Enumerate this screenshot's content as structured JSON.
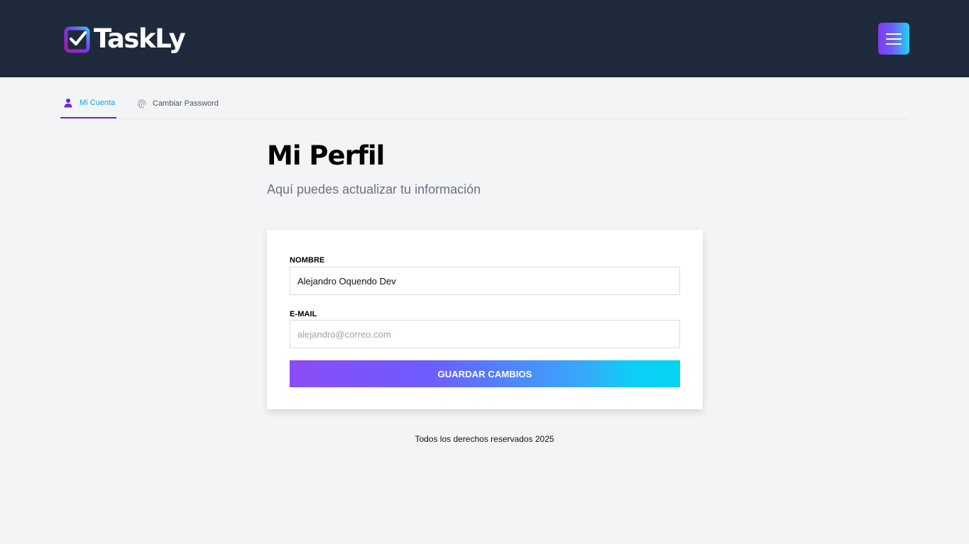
{
  "header": {
    "logo_text": "TaskLy",
    "menu_icon": "hamburger-icon",
    "colors": {
      "background": "#1e293b",
      "accent_start": "#7c3aed",
      "accent_end": "#22d3ee"
    }
  },
  "tabs": [
    {
      "label": "Mi Cuenta",
      "icon": "user-icon",
      "active": true
    },
    {
      "label": "Cambiar Password",
      "icon": "fingerprint-icon",
      "active": false
    }
  ],
  "page": {
    "title": "Mi Perfil",
    "subtitle": "Aquí puedes actualizar tu información"
  },
  "form": {
    "name_label": "Nombre",
    "name_value": "Alejandro Oquendo Dev",
    "email_label": "E-mail",
    "email_value": "",
    "email_placeholder": "alejandro@correo.com",
    "submit_label": "Guardar Cambios"
  },
  "footer": {
    "text": "Todos los derechos reservados 2025"
  }
}
